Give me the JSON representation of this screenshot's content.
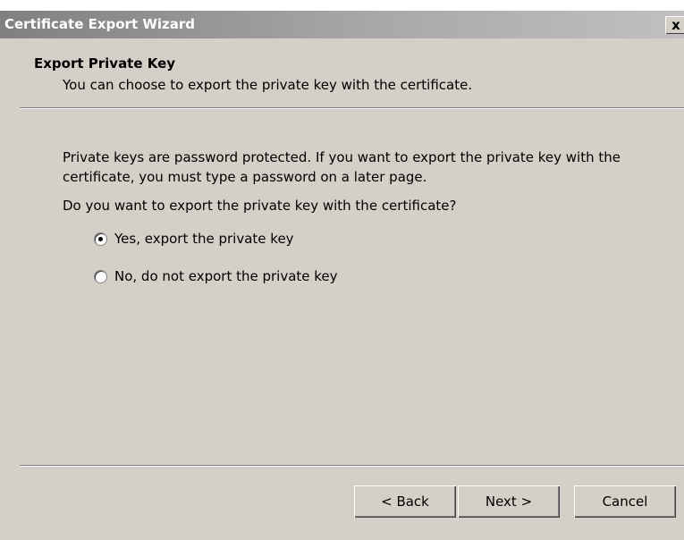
{
  "window": {
    "title": "Certificate Export Wizard",
    "close_label": "x"
  },
  "header": {
    "title": "Export Private Key",
    "subtitle": "You can choose to export the private key with the certificate."
  },
  "body": {
    "paragraph_line1": "Private keys are password protected. If you want to export the private key with the",
    "paragraph_line2": "certificate, you must type a password on a later page.",
    "question": "Do you want to export the private key with the certificate?",
    "options": [
      {
        "label": "Yes, export the private key",
        "selected": true
      },
      {
        "label": "No, do not export the private key",
        "selected": false
      }
    ]
  },
  "buttons": {
    "back": "< Back",
    "next": "Next >",
    "cancel": "Cancel"
  }
}
